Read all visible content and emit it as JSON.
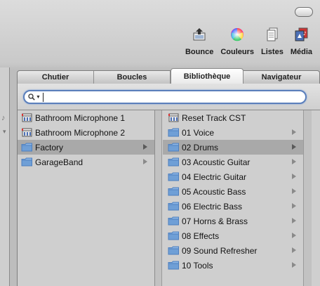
{
  "toolbar": {
    "items": [
      {
        "label": "Bounce",
        "icon": "bounce-icon"
      },
      {
        "label": "Couleurs",
        "icon": "color-wheel-icon"
      },
      {
        "label": "Listes",
        "icon": "lists-icon"
      },
      {
        "label": "Média",
        "icon": "media-icon"
      }
    ]
  },
  "tabs": [
    {
      "label": "Chutier",
      "active": false
    },
    {
      "label": "Boucles",
      "active": false
    },
    {
      "label": "Bibliothèque",
      "active": true
    },
    {
      "label": "Navigateur",
      "active": false
    }
  ],
  "search": {
    "value": "",
    "placeholder": ""
  },
  "left_column": [
    {
      "label": "Bathroom Microphone 1",
      "icon": "channel-strip-icon",
      "selected": false,
      "has_children": false
    },
    {
      "label": "Bathroom Microphone 2",
      "icon": "channel-strip-icon",
      "selected": false,
      "has_children": false
    },
    {
      "label": "Factory",
      "icon": "folder-icon",
      "selected": true,
      "has_children": true
    },
    {
      "label": "GarageBand",
      "icon": "folder-icon",
      "selected": false,
      "has_children": true
    }
  ],
  "right_column": [
    {
      "label": "Reset Track CST",
      "icon": "channel-strip-icon",
      "selected": false,
      "has_children": false
    },
    {
      "label": "01 Voice",
      "icon": "folder-icon",
      "selected": false,
      "has_children": true
    },
    {
      "label": "02 Drums",
      "icon": "folder-icon",
      "selected": true,
      "has_children": true
    },
    {
      "label": "03 Acoustic Guitar",
      "icon": "folder-icon",
      "selected": false,
      "has_children": true
    },
    {
      "label": "04 Electric Guitar",
      "icon": "folder-icon",
      "selected": false,
      "has_children": true
    },
    {
      "label": "05 Acoustic Bass",
      "icon": "folder-icon",
      "selected": false,
      "has_children": true
    },
    {
      "label": "06 Electric Bass",
      "icon": "folder-icon",
      "selected": false,
      "has_children": true
    },
    {
      "label": "07 Horns & Brass",
      "icon": "folder-icon",
      "selected": false,
      "has_children": true
    },
    {
      "label": "08 Effects",
      "icon": "folder-icon",
      "selected": false,
      "has_children": true
    },
    {
      "label": "09 Sound Refresher",
      "icon": "folder-icon",
      "selected": false,
      "has_children": true
    },
    {
      "label": "10 Tools",
      "icon": "folder-icon",
      "selected": false,
      "has_children": true
    }
  ],
  "colors": {
    "selection": "#a9a9a9",
    "folder": "#6f9fd6",
    "search_ring": "#5b7fbb"
  }
}
